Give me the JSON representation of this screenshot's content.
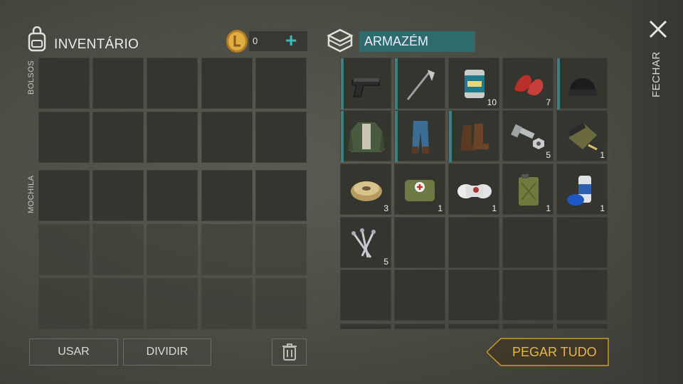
{
  "inventory": {
    "title": "INVENTÁRIO",
    "coins": "0",
    "add_symbol": "+",
    "section_pockets": "BOLSOS",
    "section_backpack": "MOCHILA"
  },
  "storage": {
    "title": "ARMAZÉM",
    "items": [
      {
        "icon": "pistol-icon",
        "qty": ""
      },
      {
        "icon": "hoe-icon",
        "qty": ""
      },
      {
        "icon": "canned-beans-icon",
        "qty": "10"
      },
      {
        "icon": "raw-meat-icon",
        "qty": "7"
      },
      {
        "icon": "beanie-hat-icon",
        "qty": ""
      },
      {
        "icon": "jacket-icon",
        "qty": ""
      },
      {
        "icon": "jeans-icon",
        "qty": ""
      },
      {
        "icon": "boots-icon",
        "qty": ""
      },
      {
        "icon": "bolt-nut-icon",
        "qty": "5"
      },
      {
        "icon": "weapon-parts-icon",
        "qty": "1"
      },
      {
        "icon": "wire-spool-icon",
        "qty": "3"
      },
      {
        "icon": "first-aid-bag-icon",
        "qty": "1"
      },
      {
        "icon": "bandage-icon",
        "qty": "1"
      },
      {
        "icon": "jerrycan-icon",
        "qty": "1"
      },
      {
        "icon": "spray-paint-icon",
        "qty": "1"
      },
      {
        "icon": "nails-icon",
        "qty": "5"
      }
    ]
  },
  "buttons": {
    "use": "USAR",
    "split": "DIVIDIR",
    "take_all": "PEGAR TUDO",
    "close": "FECHAR"
  },
  "colors": {
    "accent_teal": "#2d6b6d",
    "take_all": "#e9b640",
    "coin": "#d8a23a"
  }
}
